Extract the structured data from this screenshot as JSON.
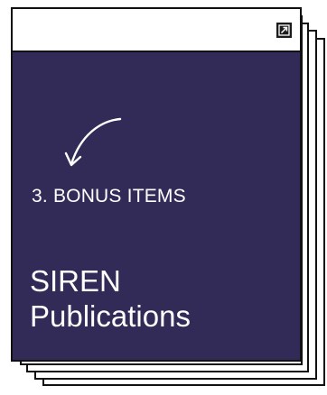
{
  "card": {
    "section_label": "3. BONUS ITEMS",
    "title_line1": "SIREN",
    "title_line2": "Publications",
    "expand_icon": "expand-arrow-icon",
    "arrow_icon": "curved-arrow-down-left-icon"
  },
  "colors": {
    "panel_background": "#332b57",
    "text": "#ffffff",
    "border": "#111111"
  }
}
